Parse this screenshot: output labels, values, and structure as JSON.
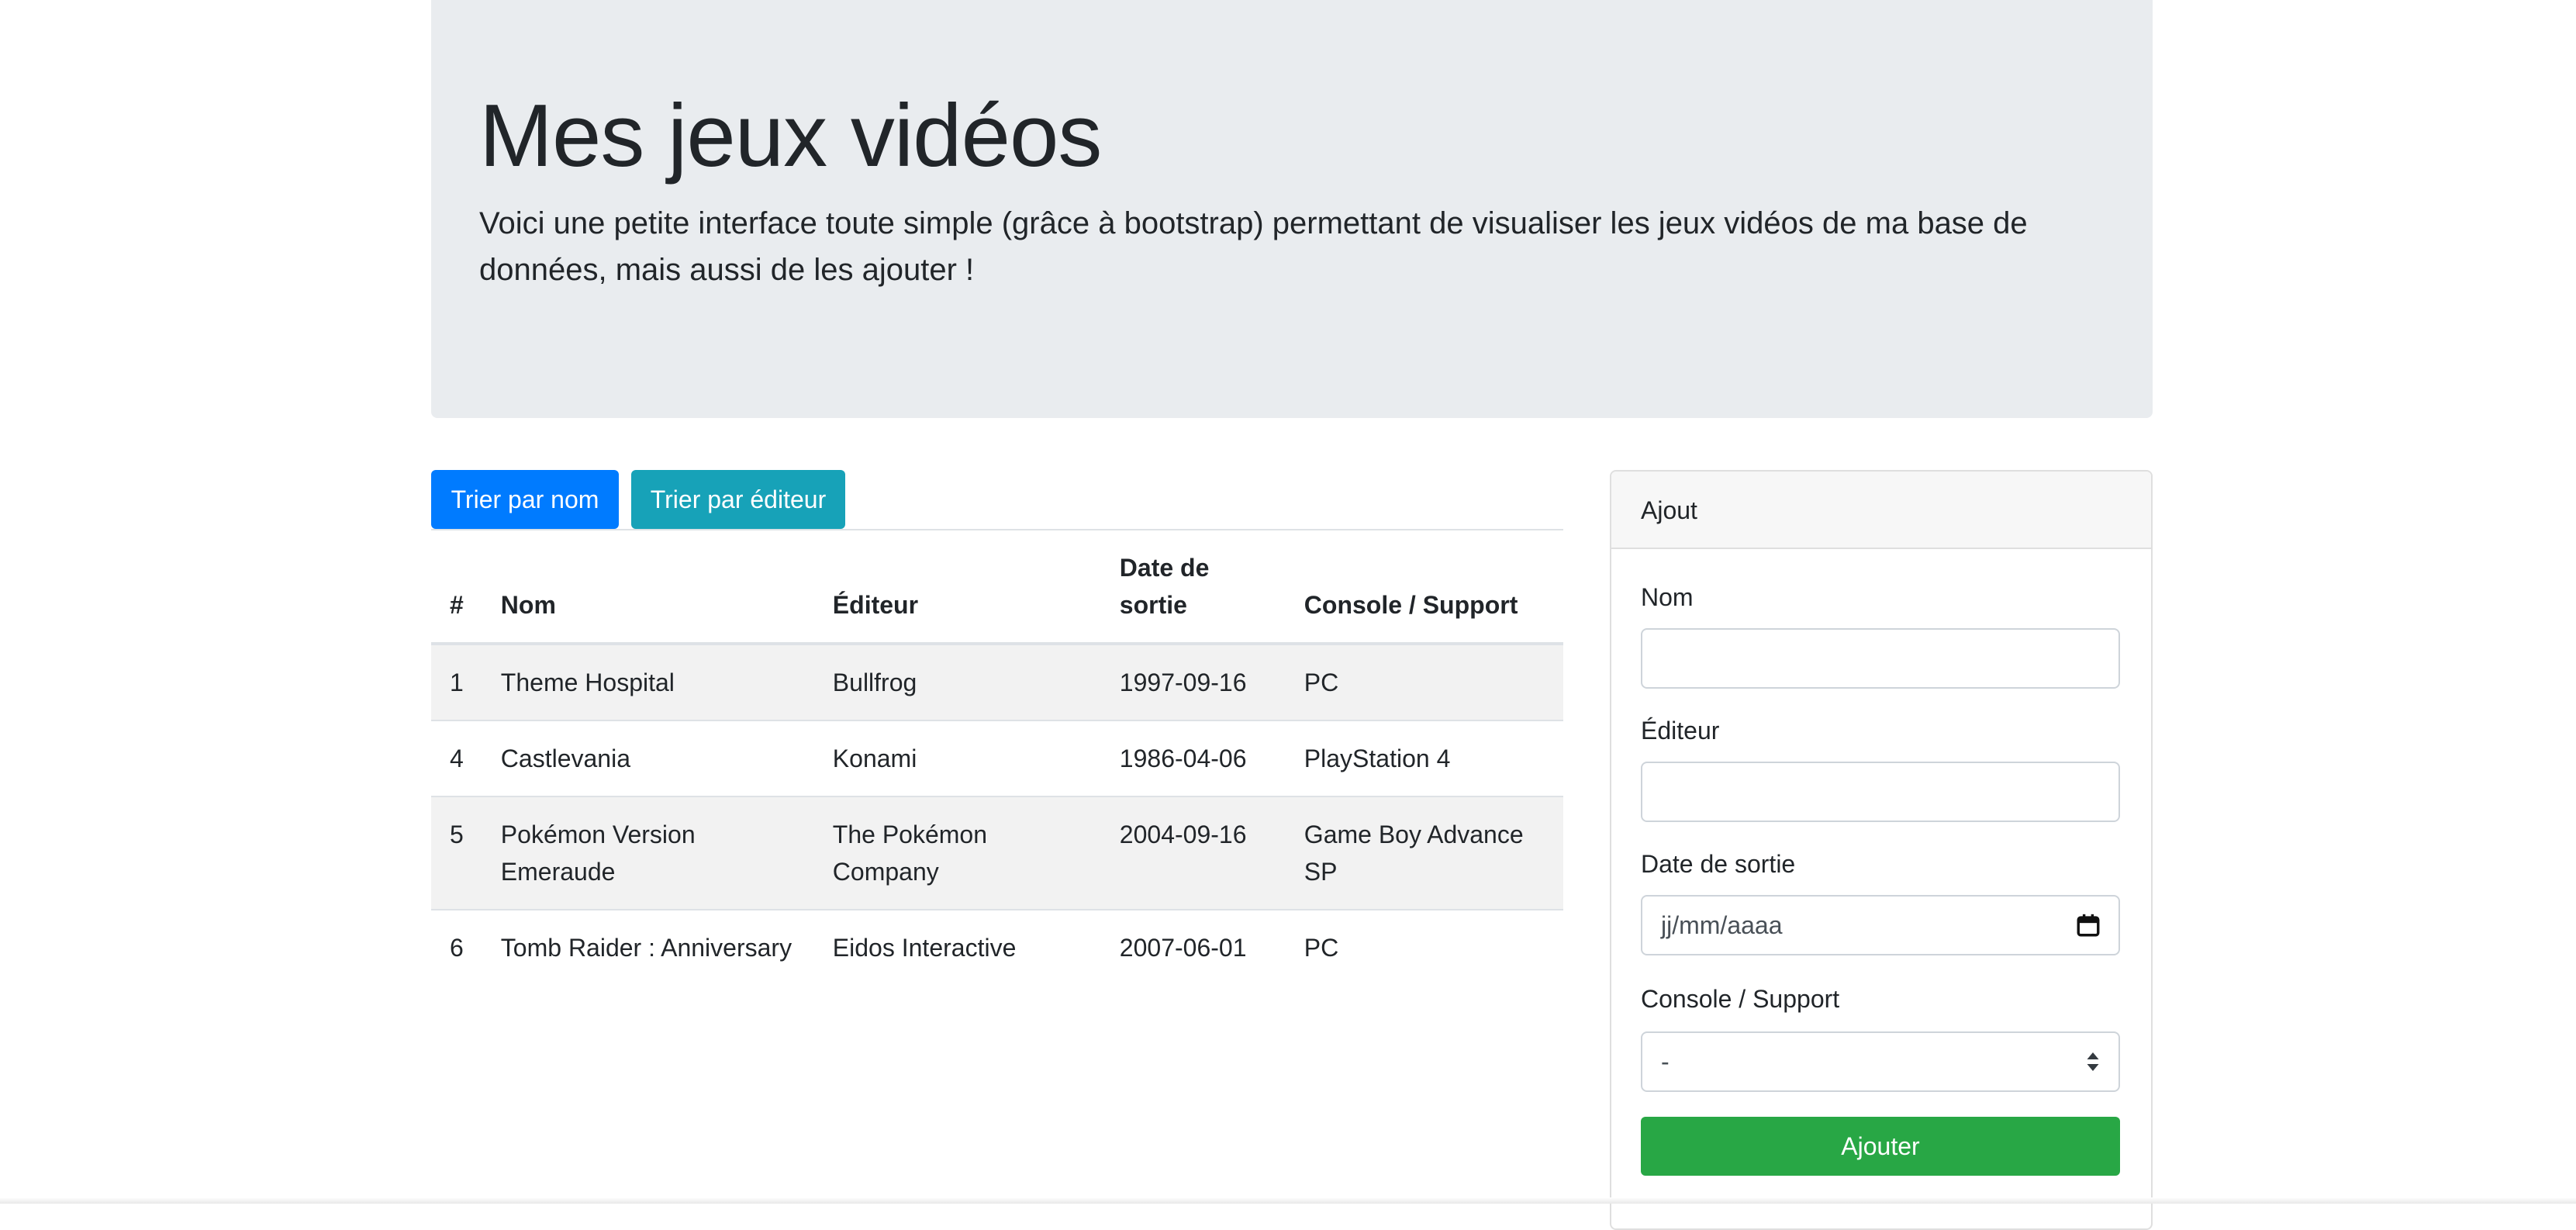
{
  "header": {
    "title": "Mes jeux vidéos",
    "lead": "Voici une petite interface toute simple (grâce à bootstrap) permettant de visualiser les jeux vidéos de ma base de données, mais aussi de les ajouter !"
  },
  "toolbar": {
    "sort_by_name": "Trier par nom",
    "sort_by_editor": "Trier par éditeur"
  },
  "table": {
    "headers": {
      "id": "#",
      "nom": "Nom",
      "editeur": "Éditeur",
      "date": "Date de sortie",
      "console": "Console / Support"
    },
    "rows": [
      {
        "id": "1",
        "nom": "Theme Hospital",
        "editeur": "Bullfrog",
        "date": "1997-09-16",
        "console": "PC"
      },
      {
        "id": "4",
        "nom": "Castlevania",
        "editeur": "Konami",
        "date": "1986-04-06",
        "console": "PlayStation 4"
      },
      {
        "id": "5",
        "nom": "Pokémon Version Emeraude",
        "editeur": "The Pokémon Company",
        "date": "2004-09-16",
        "console": "Game Boy Advance SP"
      },
      {
        "id": "6",
        "nom": "Tomb Raider : Anniversary",
        "editeur": "Eidos Interactive",
        "date": "2007-06-01",
        "console": "PC"
      }
    ]
  },
  "form": {
    "title": "Ajout",
    "nom_label": "Nom",
    "nom_value": "",
    "editeur_label": "Éditeur",
    "editeur_value": "",
    "date_label": "Date de sortie",
    "date_placeholder": "jj/mm/aaaa",
    "console_label": "Console / Support",
    "console_selected": "-",
    "submit_label": "Ajouter"
  },
  "colors": {
    "primary": "#007bff",
    "info": "#17a2b8",
    "success": "#28a745",
    "jumbotron": "#e9ecef"
  }
}
